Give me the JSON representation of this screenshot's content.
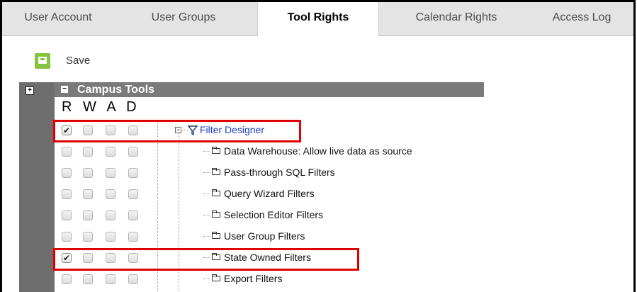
{
  "tabs": [
    {
      "label": "User Account"
    },
    {
      "label": "User Groups"
    },
    {
      "label": "Tool Rights"
    },
    {
      "label": "Calendar Rights"
    },
    {
      "label": "Access Log"
    }
  ],
  "active_tab": "Tool Rights",
  "toolbar": {
    "save_label": "Save"
  },
  "category": {
    "title": "Campus Tools"
  },
  "rights_header": "RWAD",
  "parent_tool": {
    "label": "Filter Designer",
    "rights": {
      "R": true,
      "W": false,
      "A": false,
      "D": false
    }
  },
  "children": [
    {
      "label": "Data Warehouse: Allow live data as source",
      "rights": {
        "R": false,
        "W": false,
        "A": false,
        "D": false
      }
    },
    {
      "label": "Pass-through SQL Filters",
      "rights": {
        "R": false,
        "W": false,
        "A": false,
        "D": false
      }
    },
    {
      "label": "Query Wizard Filters",
      "rights": {
        "R": false,
        "W": false,
        "A": false,
        "D": false
      }
    },
    {
      "label": "Selection Editor Filters",
      "rights": {
        "R": false,
        "W": false,
        "A": false,
        "D": false
      }
    },
    {
      "label": "User Group Filters",
      "rights": {
        "R": false,
        "W": false,
        "A": false,
        "D": false
      }
    },
    {
      "label": "State Owned Filters",
      "rights": {
        "R": true,
        "W": false,
        "A": false,
        "D": false
      }
    },
    {
      "label": "Export Filters",
      "rights": {
        "R": false,
        "W": false,
        "A": false,
        "D": false
      }
    }
  ],
  "colors": {
    "highlight": "#e00000",
    "save_icon": "#86c440",
    "link": "#1f3fcc",
    "header_bg": "#7a7a7a"
  }
}
